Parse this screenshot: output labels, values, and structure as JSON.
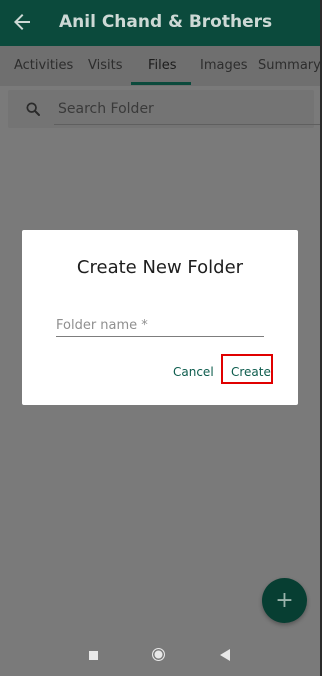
{
  "header": {
    "title": "Anil Chand & Brothers",
    "back_icon": "arrow-left-icon"
  },
  "tabs": [
    {
      "label": "Activities",
      "active": false
    },
    {
      "label": "Visits",
      "active": false
    },
    {
      "label": "Files",
      "active": true
    },
    {
      "label": "Images",
      "active": false
    },
    {
      "label": "Summary",
      "active": false
    }
  ],
  "search": {
    "placeholder": "Search Folder",
    "icon": "search-icon"
  },
  "dialog": {
    "title": "Create New Folder",
    "folder_name_placeholder": "Folder name *",
    "cancel_label": "Cancel",
    "create_label": "Create"
  },
  "fab": {
    "label": "+",
    "icon": "plus-icon"
  },
  "nav": {
    "recent_icon": "square-icon",
    "home_icon": "circle-icon",
    "back_icon": "triangle-back-icon"
  },
  "colors": {
    "primary": "#0b4a3c",
    "accent_text": "#0d5c4d",
    "highlight": "#e00000",
    "overlay": "#7a7a7a"
  }
}
